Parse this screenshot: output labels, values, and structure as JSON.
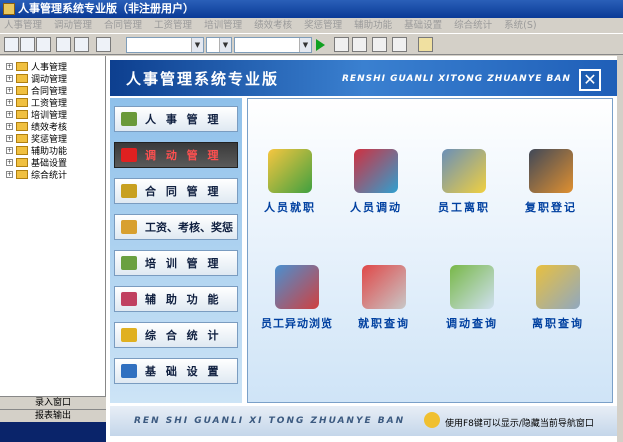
{
  "window": {
    "title": "人事管理系统专业版（非注册用户）"
  },
  "menu": [
    "人事管理",
    "调动管理",
    "合同管理",
    "工资管理",
    "培训管理",
    "绩效考核",
    "奖惩管理",
    "辅助功能",
    "基础设置",
    "综合统计",
    "系统(S)"
  ],
  "tree": [
    "人事管理",
    "调动管理",
    "合同管理",
    "工资管理",
    "培训管理",
    "绩效考核",
    "奖惩管理",
    "辅助功能",
    "基础设置",
    "综合统计"
  ],
  "sidebar_bottom": [
    "录入窗口",
    "报表输出"
  ],
  "banner": {
    "title_cn": "人事管理系统专业版",
    "title_en": "RENSHI GUANLI XITONG ZHUANYE BAN",
    "close": "✕"
  },
  "nav": [
    {
      "label": "人 事 管 理",
      "color": "#6a9a3a"
    },
    {
      "label": "调 动 管 理",
      "color": "#e02020"
    },
    {
      "label": "合 同 管 理",
      "color": "#c8a020"
    },
    {
      "label": "工资、考核、奖惩",
      "color": "#d8a030"
    },
    {
      "label": "培 训 管 理",
      "color": "#6aa040"
    },
    {
      "label": "辅 助 功 能",
      "color": "#c04060"
    },
    {
      "label": "综 合 统 计",
      "color": "#e0b020"
    },
    {
      "label": "基 础 设 置",
      "color": "#3070c0"
    }
  ],
  "features": [
    {
      "label": "人员就职",
      "c1": "#f6c640",
      "c2": "#40a040"
    },
    {
      "label": "人员调动",
      "c1": "#d03040",
      "c2": "#30a0d0"
    },
    {
      "label": "员工离职",
      "c1": "#6a8fb8",
      "c2": "#f0d040"
    },
    {
      "label": "复职登记",
      "c1": "#404858",
      "c2": "#e09030"
    },
    {
      "label": "员工异动浏览",
      "c1": "#4a90d0",
      "c2": "#d04040"
    },
    {
      "label": "就职查询",
      "c1": "#e04848",
      "c2": "#c8c8c8"
    },
    {
      "label": "调动查询",
      "c1": "#78b848",
      "c2": "#d0e0f0"
    },
    {
      "label": "离职查询",
      "c1": "#e8c040",
      "c2": "#90a8c0"
    }
  ],
  "footer": {
    "text": "REN SHI GUANLI XI TONG ZHUANYE BAN",
    "hint": "使用F8键可以显示/隐藏当前导航窗口"
  }
}
